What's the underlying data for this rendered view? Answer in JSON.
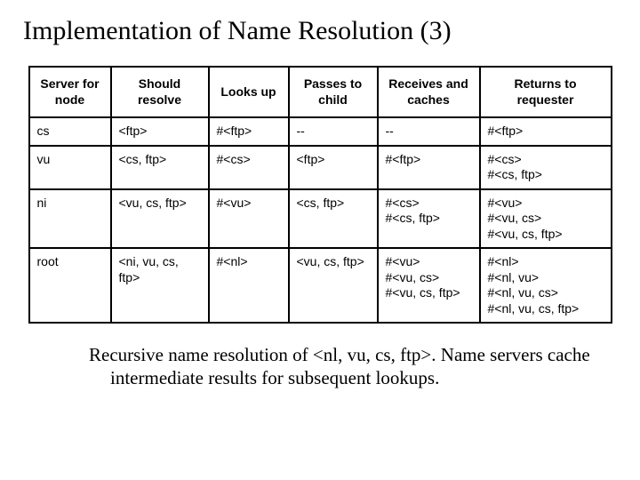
{
  "title": "Implementation of Name Resolution (3)",
  "table": {
    "headers": [
      "Server for node",
      "Should resolve",
      "Looks up",
      "Passes to child",
      "Receives and caches",
      "Returns to requester"
    ],
    "rows": [
      {
        "server": "cs",
        "resolve": "<ftp>",
        "looks_up": "#<ftp>",
        "passes": "--",
        "caches": "--",
        "returns": "#<ftp>"
      },
      {
        "server": "vu",
        "resolve": "<cs, ftp>",
        "looks_up": "#<cs>",
        "passes": "<ftp>",
        "caches": "#<ftp>",
        "returns": "#<cs>\n#<cs, ftp>"
      },
      {
        "server": "ni",
        "resolve": "<vu, cs, ftp>",
        "looks_up": "#<vu>",
        "passes": "<cs, ftp>",
        "caches": "#<cs>\n#<cs, ftp>",
        "returns": "#<vu>\n#<vu, cs>\n#<vu, cs, ftp>"
      },
      {
        "server": "root",
        "resolve": "<ni, vu, cs, ftp>",
        "looks_up": "#<nl>",
        "passes": "<vu, cs, ftp>",
        "caches": "#<vu>\n#<vu, cs>\n#<vu, cs, ftp>",
        "returns": "#<nl>\n#<nl, vu>\n#<nl, vu, cs>\n#<nl, vu, cs, ftp>"
      }
    ]
  },
  "caption": {
    "lead": "Recursive name resolution of <nl, vu, cs, ftp>.",
    "rest": " Name servers cache intermediate results for subsequent lookups."
  }
}
